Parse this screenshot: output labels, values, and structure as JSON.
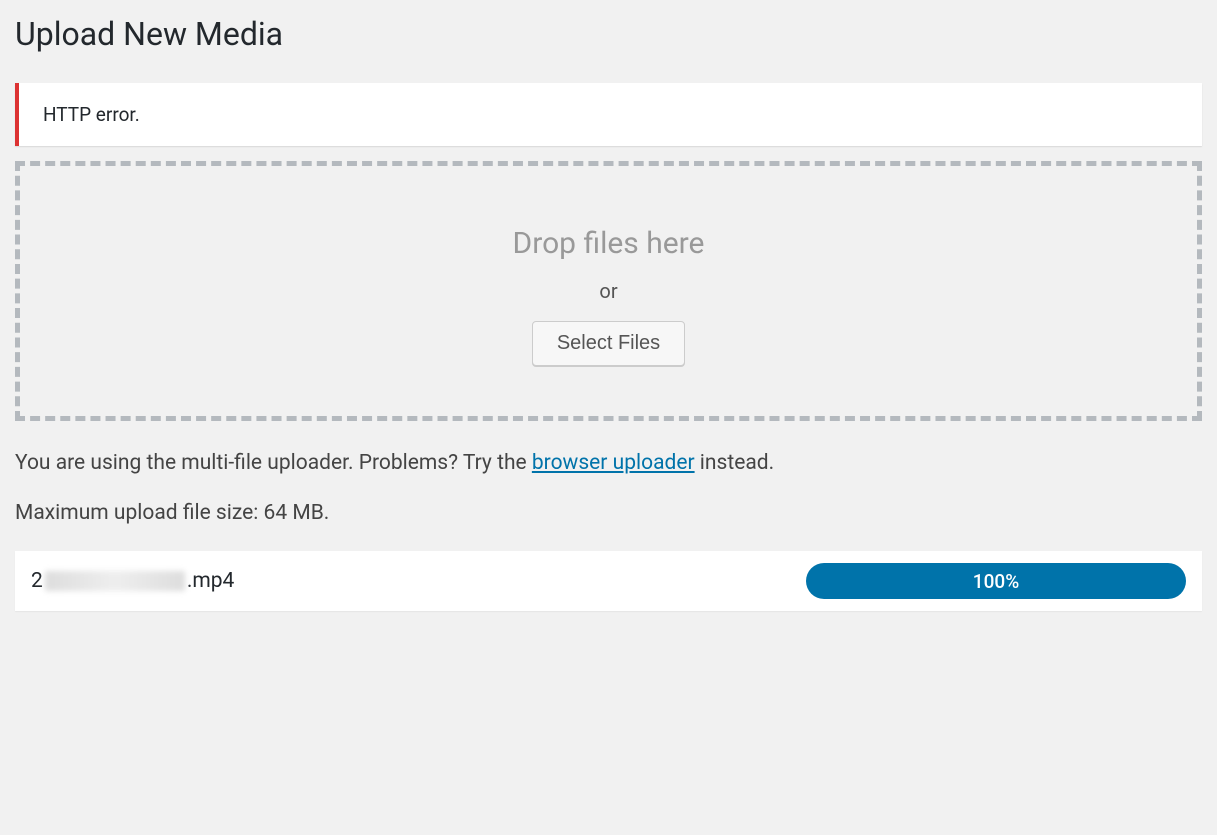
{
  "page": {
    "title": "Upload New Media"
  },
  "error": {
    "message": "HTTP error."
  },
  "dropzone": {
    "heading": "Drop files here",
    "or": "or",
    "button": "Select Files"
  },
  "info": {
    "prefix": "You are using the multi-file uploader. Problems? Try the ",
    "link": "browser uploader",
    "suffix": " instead.",
    "max_size": "Maximum upload file size: 64 MB."
  },
  "upload": {
    "filename_prefix": "2",
    "filename_suffix": ".mp4",
    "progress": "100%"
  }
}
